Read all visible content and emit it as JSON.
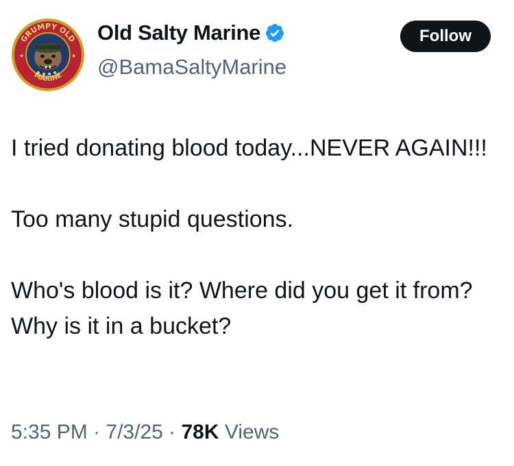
{
  "author": {
    "display_name": "Old Salty Marine",
    "handle": "@BamaSaltyMarine",
    "verified": true,
    "avatar_icon": "bulldog-marine-logo-icon",
    "avatar_text": {
      "top": "GRUMPY OLD",
      "bottom": "MARINE"
    }
  },
  "follow_button": {
    "label": "Follow"
  },
  "tweet": {
    "paragraphs": [
      "I tried donating blood today...NEVER AGAIN!!!",
      "Too many stupid questions.",
      "Who's blood is it? Where did you get it from? Why is it in a bucket?"
    ],
    "time": "5:35 PM",
    "separator": " · ",
    "date": "7/3/25",
    "views_count": "78K",
    "views_label": " Views"
  },
  "colors": {
    "text": "#0f1419",
    "secondary": "#536471",
    "verified_blue": "#1d9bf0",
    "button_bg": "#0f1419",
    "button_text": "#ffffff",
    "avatar_ring": "#c9a227",
    "avatar_inner": "#1f3a6b",
    "avatar_outer": "#b8232f"
  }
}
